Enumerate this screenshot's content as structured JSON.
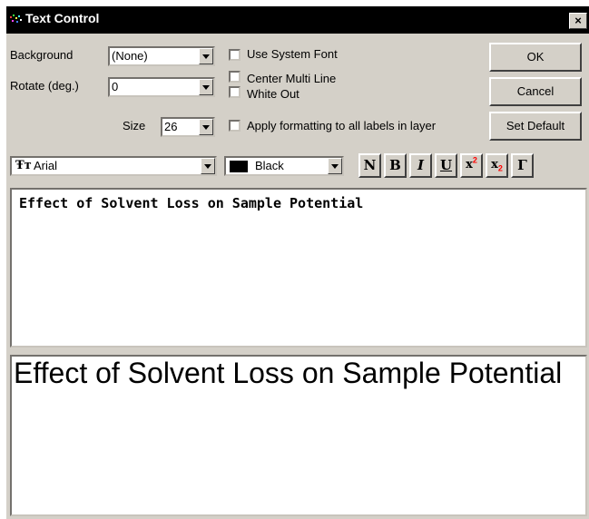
{
  "window": {
    "title": "Text Control",
    "close_label": "×"
  },
  "background": {
    "label": "Background",
    "value": "(None)"
  },
  "rotate": {
    "label": "Rotate (deg.)",
    "value": "0"
  },
  "size": {
    "label": "Size",
    "value": "26"
  },
  "options": {
    "use_system_font": "Use System Font",
    "center_multi_line": "Center Multi Line",
    "white_out": "White Out",
    "apply_formatting": "Apply formatting to all labels in layer"
  },
  "buttons": {
    "ok": "OK",
    "cancel": "Cancel",
    "set_default": "Set Default"
  },
  "font": {
    "icon": "truetype-icon",
    "value": "Arial"
  },
  "color": {
    "value": "Black",
    "swatch": "#000000"
  },
  "format_buttons": {
    "normal": "N",
    "bold": "B",
    "italic": "I",
    "underline": "U",
    "superscript": "x",
    "subscript": "x",
    "greek": "Γ",
    "script_digit": "2",
    "script_color": "#ff0000"
  },
  "editor": {
    "text": "Effect of Solvent Loss on Sample Potential"
  },
  "preview": {
    "text": "Effect of Solvent Loss on Sample Potential"
  }
}
